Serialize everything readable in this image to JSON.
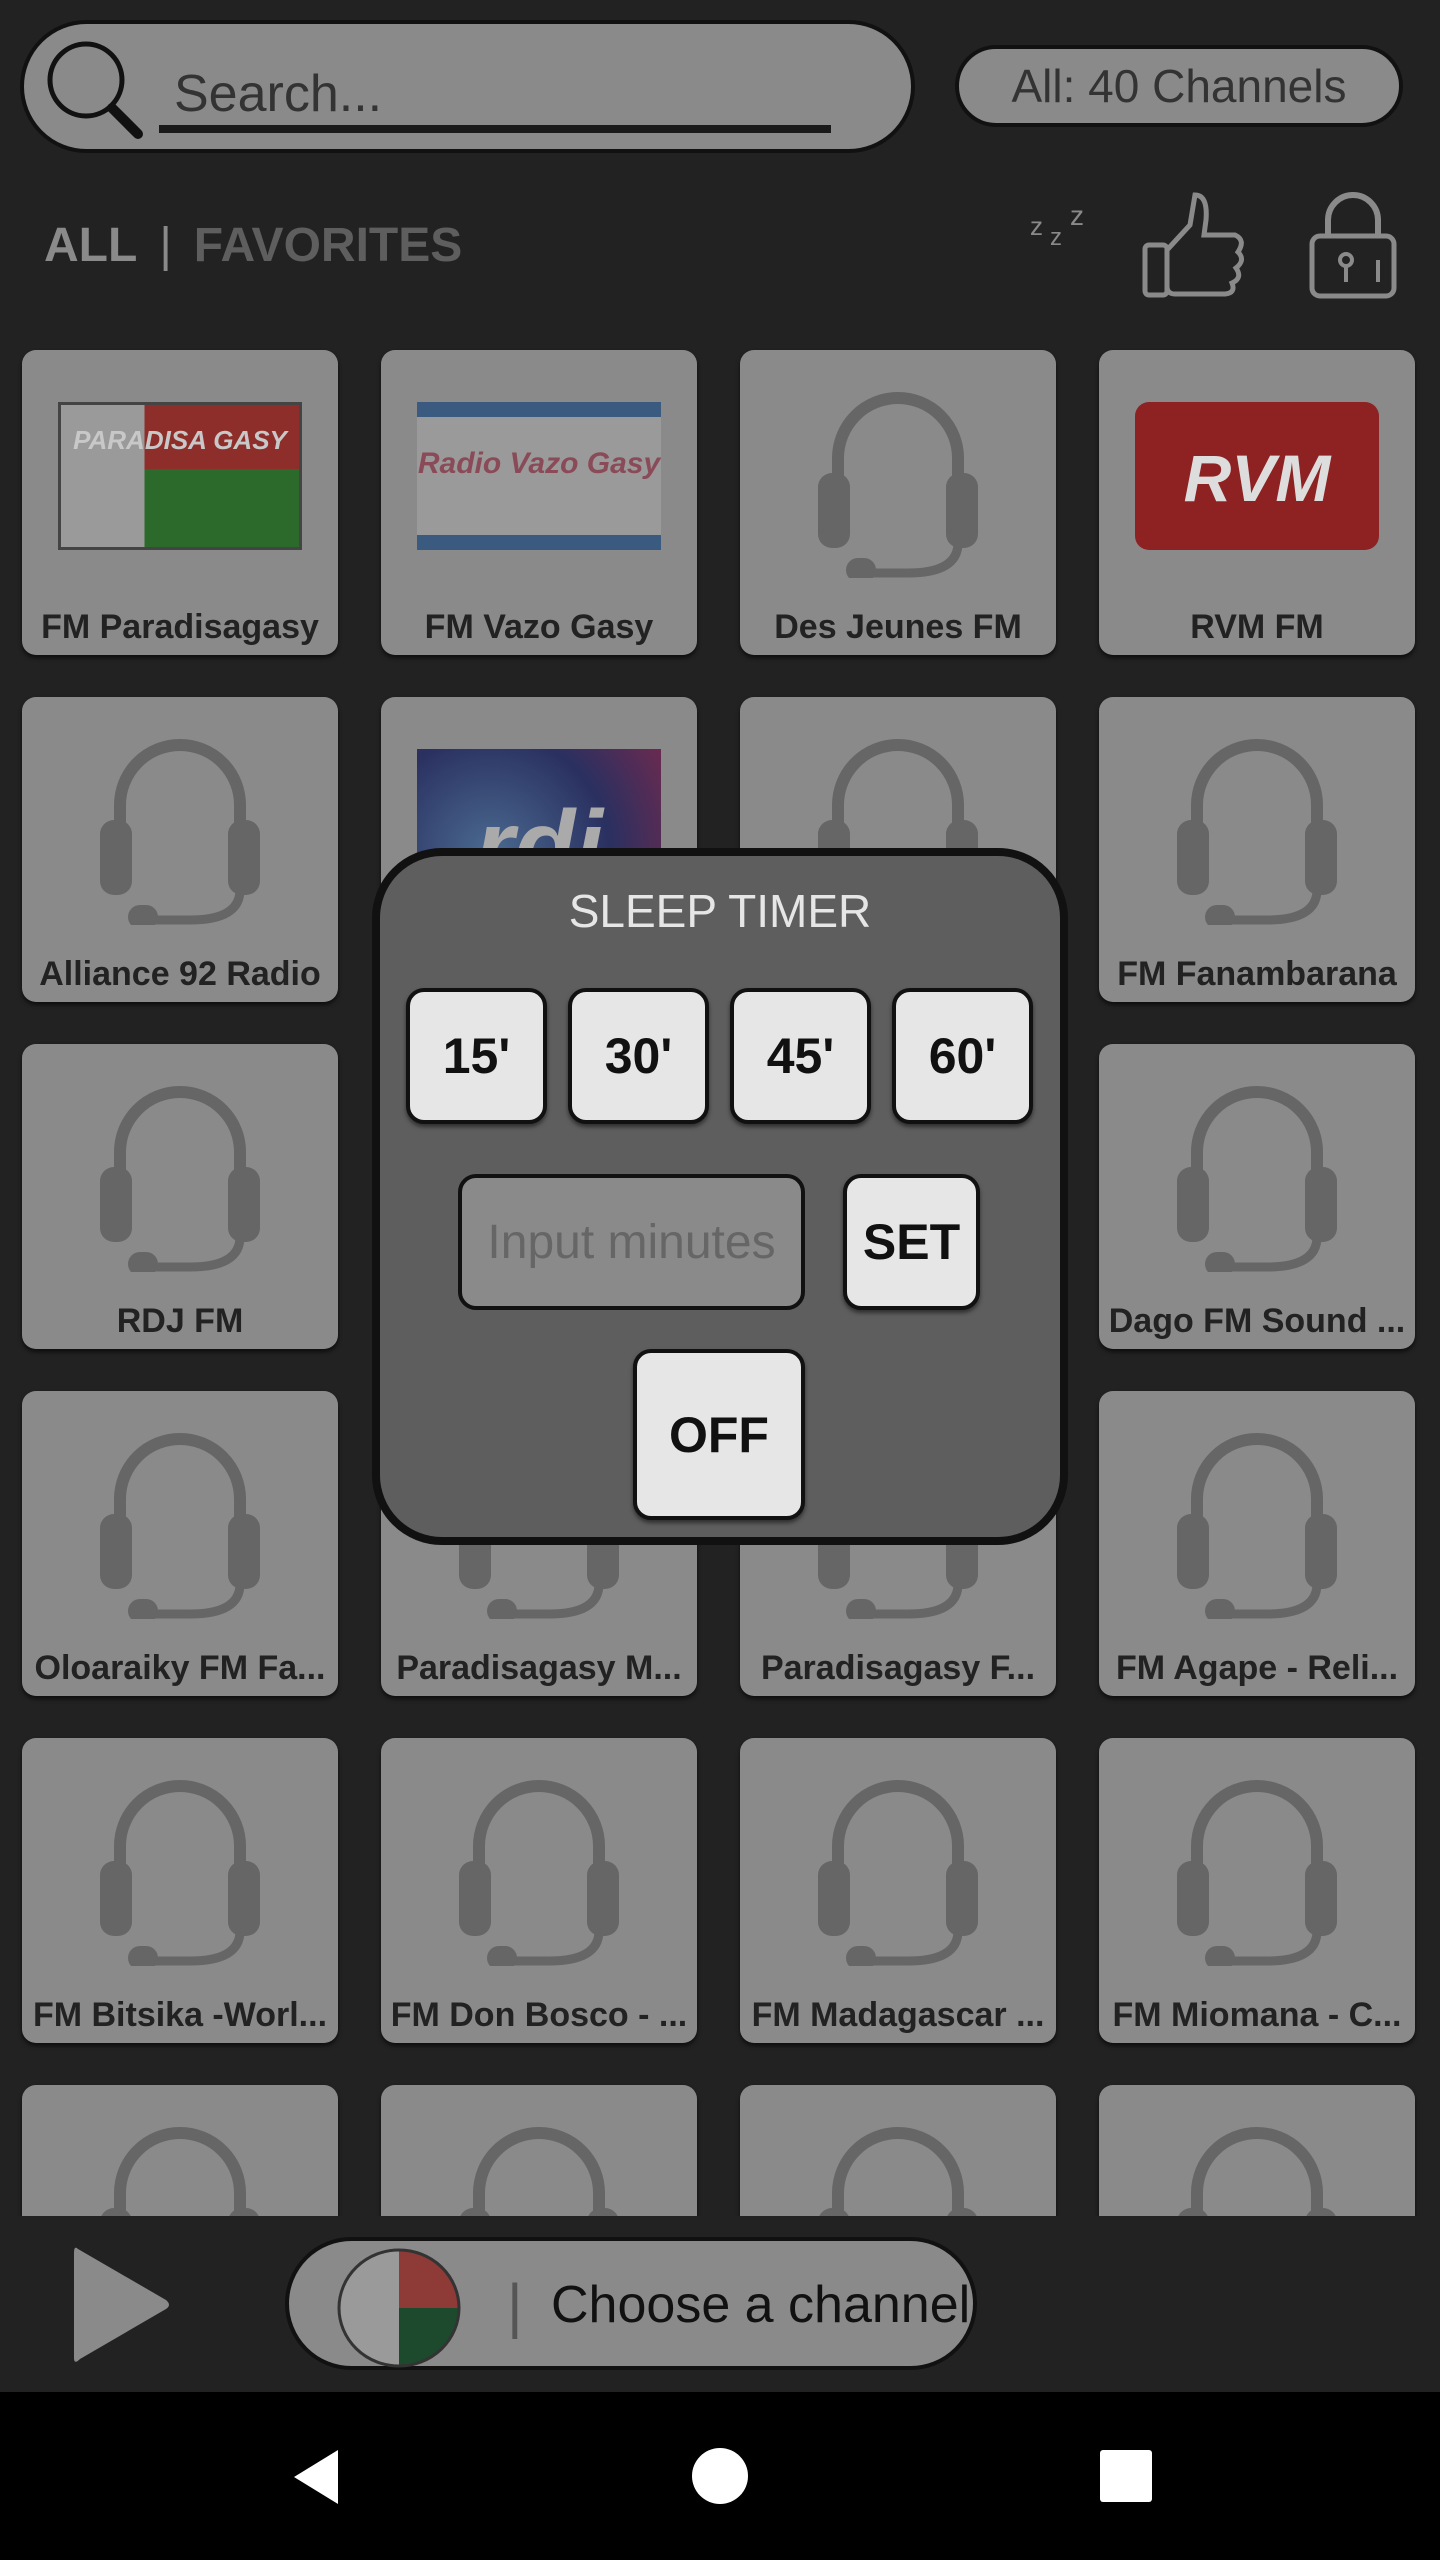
{
  "search": {
    "placeholder": "Search..."
  },
  "channel_count": "All: 40 Channels",
  "tabs": {
    "all": "ALL",
    "separator": "|",
    "favorites": "FAVORITES"
  },
  "toolbar_icons": [
    "sleep-timer-moon-icon",
    "thumbs-up-icon",
    "lock-icon"
  ],
  "channels": [
    {
      "name": "FM Paradisagasy",
      "logo": "paradisa"
    },
    {
      "name": "FM Vazo Gasy",
      "logo": "vazo"
    },
    {
      "name": "Des Jeunes FM",
      "logo": "headphones"
    },
    {
      "name": "RVM FM",
      "logo": "rvm"
    },
    {
      "name": "Alliance 92 Radio",
      "logo": "headphones"
    },
    {
      "name": "",
      "logo": "rdi"
    },
    {
      "name": "",
      "logo": "headphones"
    },
    {
      "name": "FM Fanambarana",
      "logo": "headphones"
    },
    {
      "name": "RDJ FM",
      "logo": "headphones"
    },
    {
      "name": "",
      "logo": "headphones"
    },
    {
      "name": "",
      "logo": "headphones"
    },
    {
      "name": "Dago FM Sound ...",
      "logo": "headphones"
    },
    {
      "name": "Oloaraiky FM Fa...",
      "logo": "headphones"
    },
    {
      "name": "Paradisagasy M...",
      "logo": "headphones"
    },
    {
      "name": "Paradisagasy F...",
      "logo": "headphones"
    },
    {
      "name": "FM Agape - Reli...",
      "logo": "headphones"
    },
    {
      "name": "FM Bitsika -Worl...",
      "logo": "headphones"
    },
    {
      "name": "FM Don Bosco - ...",
      "logo": "headphones"
    },
    {
      "name": "FM Madagascar ...",
      "logo": "headphones"
    },
    {
      "name": "FM Miomana - C...",
      "logo": "headphones"
    },
    {
      "name": "",
      "logo": "headphones"
    },
    {
      "name": "",
      "logo": "headphones"
    },
    {
      "name": "",
      "logo": "headphones"
    },
    {
      "name": "",
      "logo": "headphones"
    }
  ],
  "logo_text": {
    "paradisa": "PARADISA GASY",
    "vazo": "Radio Vazo Gasy",
    "rvm": "RVM",
    "rdi": "rdi"
  },
  "sleep_timer": {
    "title": "SLEEP TIMER",
    "presets": [
      "15'",
      "30'",
      "45'",
      "60'"
    ],
    "input_placeholder": "Input minutes",
    "set_label": "SET",
    "off_label": "OFF"
  },
  "player": {
    "status": "Choose a channel",
    "separator": "|"
  },
  "colors": {
    "background": "#222222",
    "tile": "#8a8a8a",
    "dialog": "#5e5e5e",
    "button": "#e6e6e6",
    "flag_red": "#8e3a36",
    "flag_green": "#1d4a2c"
  }
}
